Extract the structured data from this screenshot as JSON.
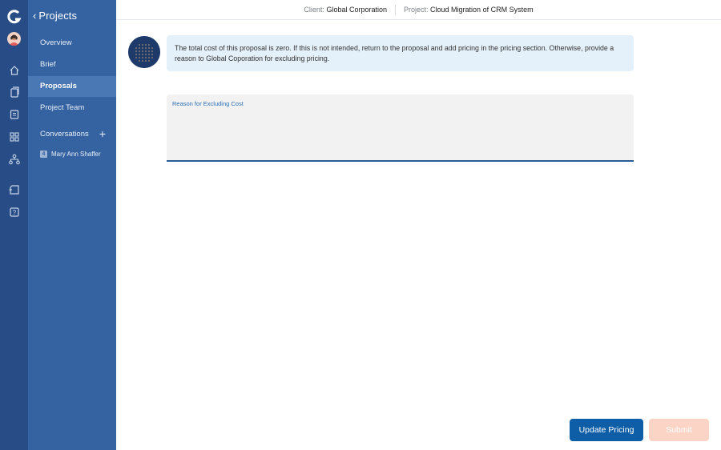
{
  "sidebar": {
    "title": "Projects",
    "back": "‹",
    "nav": [
      {
        "label": "Overview"
      },
      {
        "label": "Brief"
      },
      {
        "label": "Proposals"
      },
      {
        "label": "Project Team"
      }
    ],
    "conversations_label": "Conversations",
    "add_symbol": "+",
    "person": {
      "badge": "4",
      "name": "Mary Ann Shaffer"
    }
  },
  "topbar": {
    "client_label": "Client:",
    "client_value": "Global Corporation",
    "project_label": "Project:",
    "project_value": "Cloud Migration of CRM System"
  },
  "message": {
    "text": "The total cost of this proposal is zero. If this is not intended, return to the proposal and add pricing in the pricing section. Otherwise, provide a reason to Global Coporation for excluding pricing."
  },
  "reason_field": {
    "label": "Reason for Excluding Cost",
    "value": ""
  },
  "buttons": {
    "update": "Update Pricing",
    "submit": "Submit"
  },
  "colors": {
    "rail": "#284c85",
    "sidebar": "#3563a2",
    "active": "#4a78b5",
    "primary": "#0d5ea7",
    "submit_disabled": "#fbd4c5",
    "message_bg": "#e4f1fa"
  },
  "icons": {
    "logo": "g-logo-icon",
    "nav_rail": [
      "home-icon",
      "document-icon",
      "notes-icon",
      "grid-icon",
      "org-chart-icon",
      "folder-icon",
      "help-icon"
    ]
  }
}
